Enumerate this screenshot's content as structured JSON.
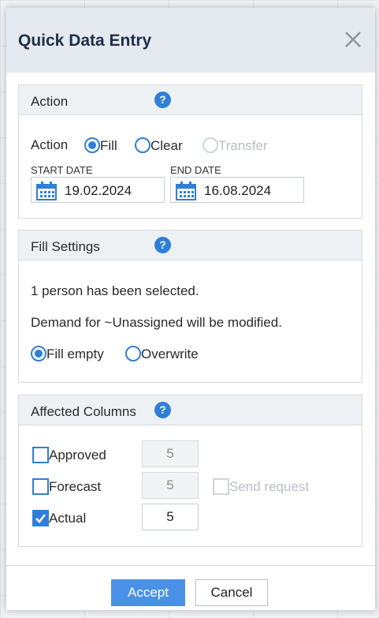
{
  "dialog": {
    "title": "Quick Data Entry"
  },
  "action_section": {
    "header": "Action",
    "row_label": "Action",
    "options": [
      {
        "label": "Fill",
        "selected": true,
        "disabled": false
      },
      {
        "label": "Clear",
        "selected": false,
        "disabled": false
      },
      {
        "label": "Transfer",
        "selected": false,
        "disabled": true
      }
    ],
    "start_date_label": "START DATE",
    "start_date_value": "19.02.2024",
    "end_date_label": "END DATE",
    "end_date_value": "16.08.2024"
  },
  "fill_settings": {
    "header": "Fill Settings",
    "selection_text": "1 person has been selected.",
    "demand_text": "Demand for ~Unassigned will be modified.",
    "options": [
      {
        "label": "Fill empty",
        "selected": true
      },
      {
        "label": "Overwrite",
        "selected": false
      }
    ]
  },
  "affected_columns": {
    "header": "Affected Columns",
    "rows": [
      {
        "label": "Approved",
        "checked": false,
        "value": "5",
        "enabled": false
      },
      {
        "label": "Forecast",
        "checked": false,
        "value": "5",
        "enabled": false
      },
      {
        "label": "Actual",
        "checked": true,
        "value": "5",
        "enabled": true
      }
    ],
    "send_request_label": "Send request",
    "send_request_checked": false
  },
  "footer": {
    "accept_label": "Accept",
    "cancel_label": "Cancel"
  },
  "colors": {
    "accent": "#2f7fd8",
    "primary_button": "#4a90e6",
    "header_bg": "#e4eaef",
    "title": "#1e2f47"
  },
  "icons": {
    "close": "close-icon",
    "help": "help-icon",
    "calendar": "calendar-icon",
    "check": "checkmark-icon"
  }
}
